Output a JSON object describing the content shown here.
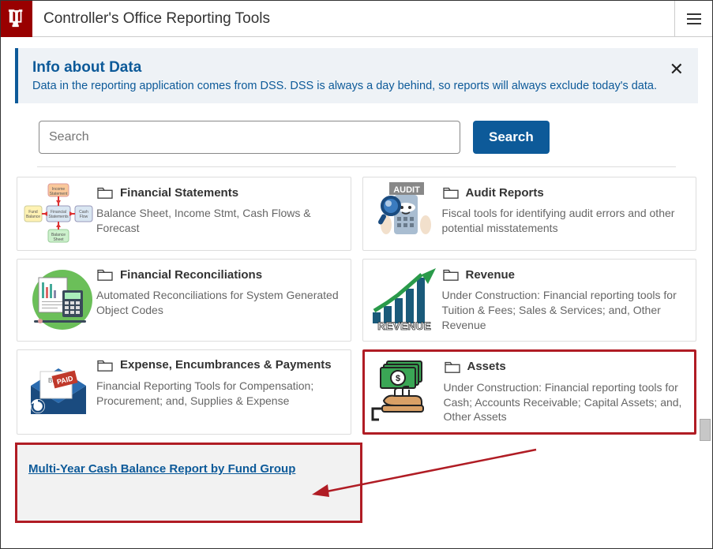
{
  "header": {
    "title": "Controller's Office Reporting Tools"
  },
  "info": {
    "title": "Info about Data",
    "text": "Data in the reporting application comes from DSS. DSS is always a day behind, so reports will always exclude today's data."
  },
  "search": {
    "placeholder": "Search",
    "button": "Search"
  },
  "cards": [
    {
      "title": "Financial Statements",
      "desc": "Balance Sheet, Income Stmt, Cash Flows & Forecast"
    },
    {
      "title": "Audit Reports",
      "desc": "Fiscal tools for identifying audit errors and other potential misstatements"
    },
    {
      "title": "Financial Reconciliations",
      "desc": "Automated Reconciliations for System Generated Object Codes"
    },
    {
      "title": "Revenue",
      "desc": "Under Construction: Financial reporting tools for Tuition & Fees; Sales & Services; and, Other Revenue"
    },
    {
      "title": "Expense, Encumbrances & Payments",
      "desc": "Financial Reporting Tools for Compensation; Procurement; and, Supplies & Expense"
    },
    {
      "title": "Assets",
      "desc": "Under Construction: Financial reporting tools for Cash; Accounts Receivable; Capital Assets; and, Other Assets"
    }
  ],
  "sub": {
    "link": "Multi-Year Cash Balance Report by Fund Group"
  }
}
